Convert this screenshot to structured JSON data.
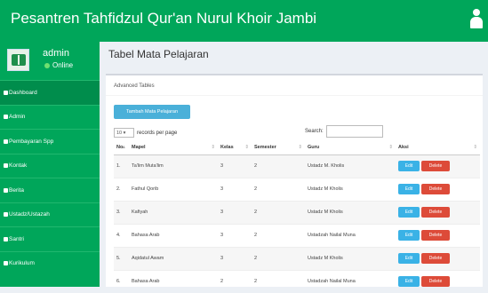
{
  "app": {
    "title": "Pesantren Tahfidzul Qur'an Nurul Khoir Jambi"
  },
  "user": {
    "name": "admin",
    "status": "Online"
  },
  "sidebar": {
    "items": [
      {
        "label": "Dashboard"
      },
      {
        "label": "Admin"
      },
      {
        "label": "Pembayaran Spp"
      },
      {
        "label": "Kontak"
      },
      {
        "label": "Berita"
      },
      {
        "label": "Ustadz/Ustazah"
      },
      {
        "label": "Santri"
      },
      {
        "label": "Kurikulum"
      }
    ]
  },
  "main": {
    "page_title": "Tabel Mata Pelajaran",
    "box_title": "Advanced Tables",
    "add_button": "Tambah Mata Pelajaran",
    "length_value": "10",
    "length_label": "records per page",
    "search_label": "Search:",
    "columns": [
      "No",
      "Mapel",
      "Kelas",
      "Semester",
      "Guru",
      "Aksi"
    ],
    "edit_label": "Edit",
    "delete_label": "Delete",
    "rows": [
      {
        "no": "1.",
        "mapel": "Ta'lim Muta'lim",
        "kelas": "3",
        "semester": "2",
        "guru": "Ustadz M. Kholis"
      },
      {
        "no": "2.",
        "mapel": "Fathul Qorib",
        "kelas": "3",
        "semester": "2",
        "guru": "Ustadz M Kholis"
      },
      {
        "no": "3.",
        "mapel": "Kafiyah",
        "kelas": "3",
        "semester": "2",
        "guru": "Ustadz M Kholis"
      },
      {
        "no": "4.",
        "mapel": "Bahasa Arab",
        "kelas": "3",
        "semester": "2",
        "guru": "Ustadzah Nailal Muna"
      },
      {
        "no": "5.",
        "mapel": "Aqidatul Awam",
        "kelas": "3",
        "semester": "2",
        "guru": "Ustadz M Kholis"
      },
      {
        "no": "6.",
        "mapel": "Bahasa Arab",
        "kelas": "2",
        "semester": "2",
        "guru": "Ustadzah Nailal Muna"
      }
    ]
  },
  "colors": {
    "primary": "#00a65a",
    "info": "#3ab2e6",
    "danger": "#dd4b39"
  }
}
